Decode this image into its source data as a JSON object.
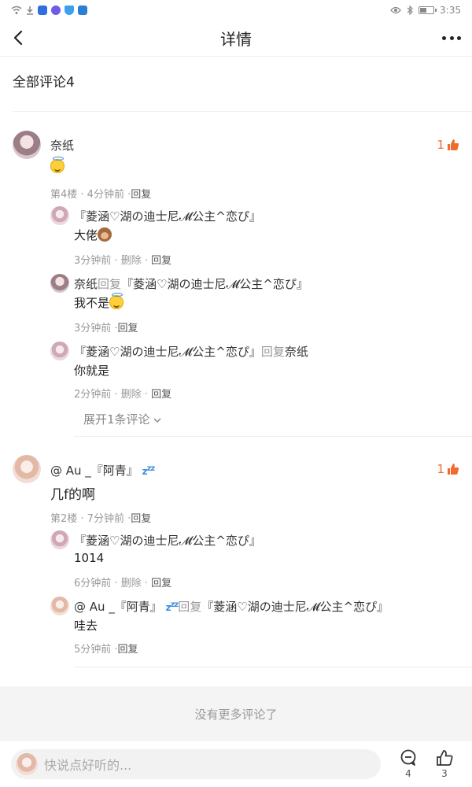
{
  "status_bar": {
    "time": "3:35"
  },
  "header": {
    "title": "详情"
  },
  "section": {
    "title": "全部评论4"
  },
  "comments": [
    {
      "name": "奈纸",
      "text": "",
      "meta_prefix": "第4楼 · 4分钟前 ·",
      "reply_label": "回复",
      "likes": "1",
      "replies": [
        {
          "name": "『菱涵♡湖の迪士尼𝓜公主^恋ぴ』",
          "reply_word": "",
          "to": "",
          "text": "大佬",
          "time": "3分钟前 ·",
          "delete": "删除 ·",
          "reply": "回复"
        },
        {
          "name": "奈纸",
          "reply_word": "回复",
          "to": "『菱涵♡湖の迪士尼𝓜公主^恋ぴ』",
          "text": "我不是",
          "time": "3分钟前 ·",
          "delete": "",
          "reply": "回复"
        },
        {
          "name": "『菱涵♡湖の迪士尼𝓜公主^恋ぴ』",
          "reply_word": "回复",
          "to": "奈纸",
          "text": "你就是",
          "time": "2分钟前 ·",
          "delete": "删除 ·",
          "reply": "回复"
        }
      ],
      "expand": "展开1条评论"
    },
    {
      "name": "@ Au _『阿青』",
      "text": "几f的啊",
      "meta_prefix": "第2楼 · 7分钟前 ·",
      "reply_label": "回复",
      "likes": "1",
      "replies": [
        {
          "name": "『菱涵♡湖の迪士尼𝓜公主^恋ぴ』",
          "reply_word": "",
          "to": "",
          "text": "1014",
          "time": "6分钟前 ·",
          "delete": "删除 ·",
          "reply": "回复"
        },
        {
          "name": "@ Au _『阿青』",
          "reply_word": "回复",
          "to": "『菱涵♡湖の迪士尼𝓜公主^恋ぴ』",
          "text": "哇去",
          "time": "5分钟前 ·",
          "delete": "",
          "reply": "回复"
        }
      ]
    }
  ],
  "footer": {
    "no_more": "没有更多评论了"
  },
  "bottom_bar": {
    "placeholder": "快说点好听的...",
    "comment_count": "4",
    "like_count": "3"
  }
}
